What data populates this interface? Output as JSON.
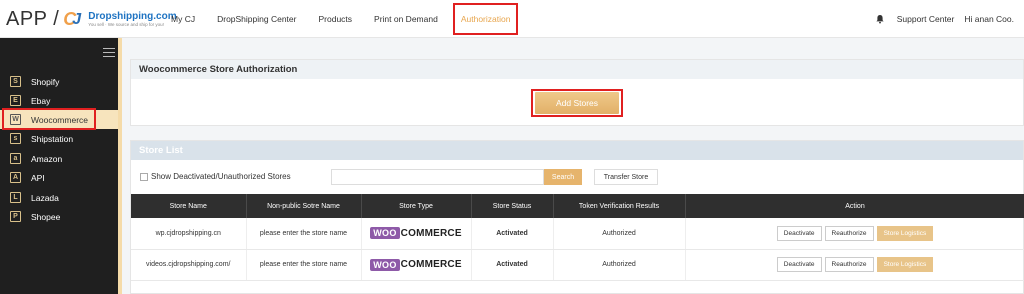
{
  "header": {
    "logo_app": "APP /",
    "logo_brand": "Dropshipping.com",
    "logo_tagline": "You sell · We source and ship for you!",
    "nav": [
      "My CJ",
      "DropShipping Center",
      "Products",
      "Print on Demand",
      "Authorization"
    ],
    "support": "Support Center",
    "greeting": "Hi anan Coo."
  },
  "sidebar": {
    "items": [
      {
        "label": "Shopify",
        "icon": "S"
      },
      {
        "label": "Ebay",
        "icon": "E"
      },
      {
        "label": "Woocommerce",
        "icon": "W"
      },
      {
        "label": "Shipstation",
        "icon": "s"
      },
      {
        "label": "Amazon",
        "icon": "a"
      },
      {
        "label": "API",
        "icon": "A"
      },
      {
        "label": "Lazada",
        "icon": "L"
      },
      {
        "label": "Shopee",
        "icon": "P"
      }
    ]
  },
  "auth_card": {
    "title": "Woocommerce Store Authorization",
    "add_button": "Add Stores"
  },
  "store_list": {
    "title": "Store List",
    "checkbox_label": "Show Deactivated/Unauthorized Stores",
    "search_button": "Search",
    "transfer_button": "Transfer Store",
    "columns": [
      "Store Name",
      "Non-public Sotre Name",
      "Store Type",
      "Store Status",
      "Token Verification Results",
      "Action"
    ],
    "rows": [
      {
        "name": "wp.cjdropshipping.cn",
        "nonpublic": "please enter the store name",
        "type_badge": "WOO",
        "type_text": "COMMERCE",
        "status": "Activated",
        "token": "Authorized",
        "actions": [
          "Deactivate",
          "Reauthorize",
          "Store Logistics"
        ]
      },
      {
        "name": "videos.cjdropshipping.com/",
        "nonpublic": "please enter the store name",
        "type_badge": "WOO",
        "type_text": "COMMERCE",
        "status": "Activated",
        "token": "Authorized",
        "actions": [
          "Deactivate",
          "Reauthorize",
          "Store Logistics"
        ]
      }
    ]
  },
  "colors": {
    "accent": "#e6b46c",
    "highlight_box": "#e02020",
    "sidebar_bg": "#1f1f1f",
    "table_head": "#2f2f2f",
    "woo_purple": "#8e5aa8"
  }
}
